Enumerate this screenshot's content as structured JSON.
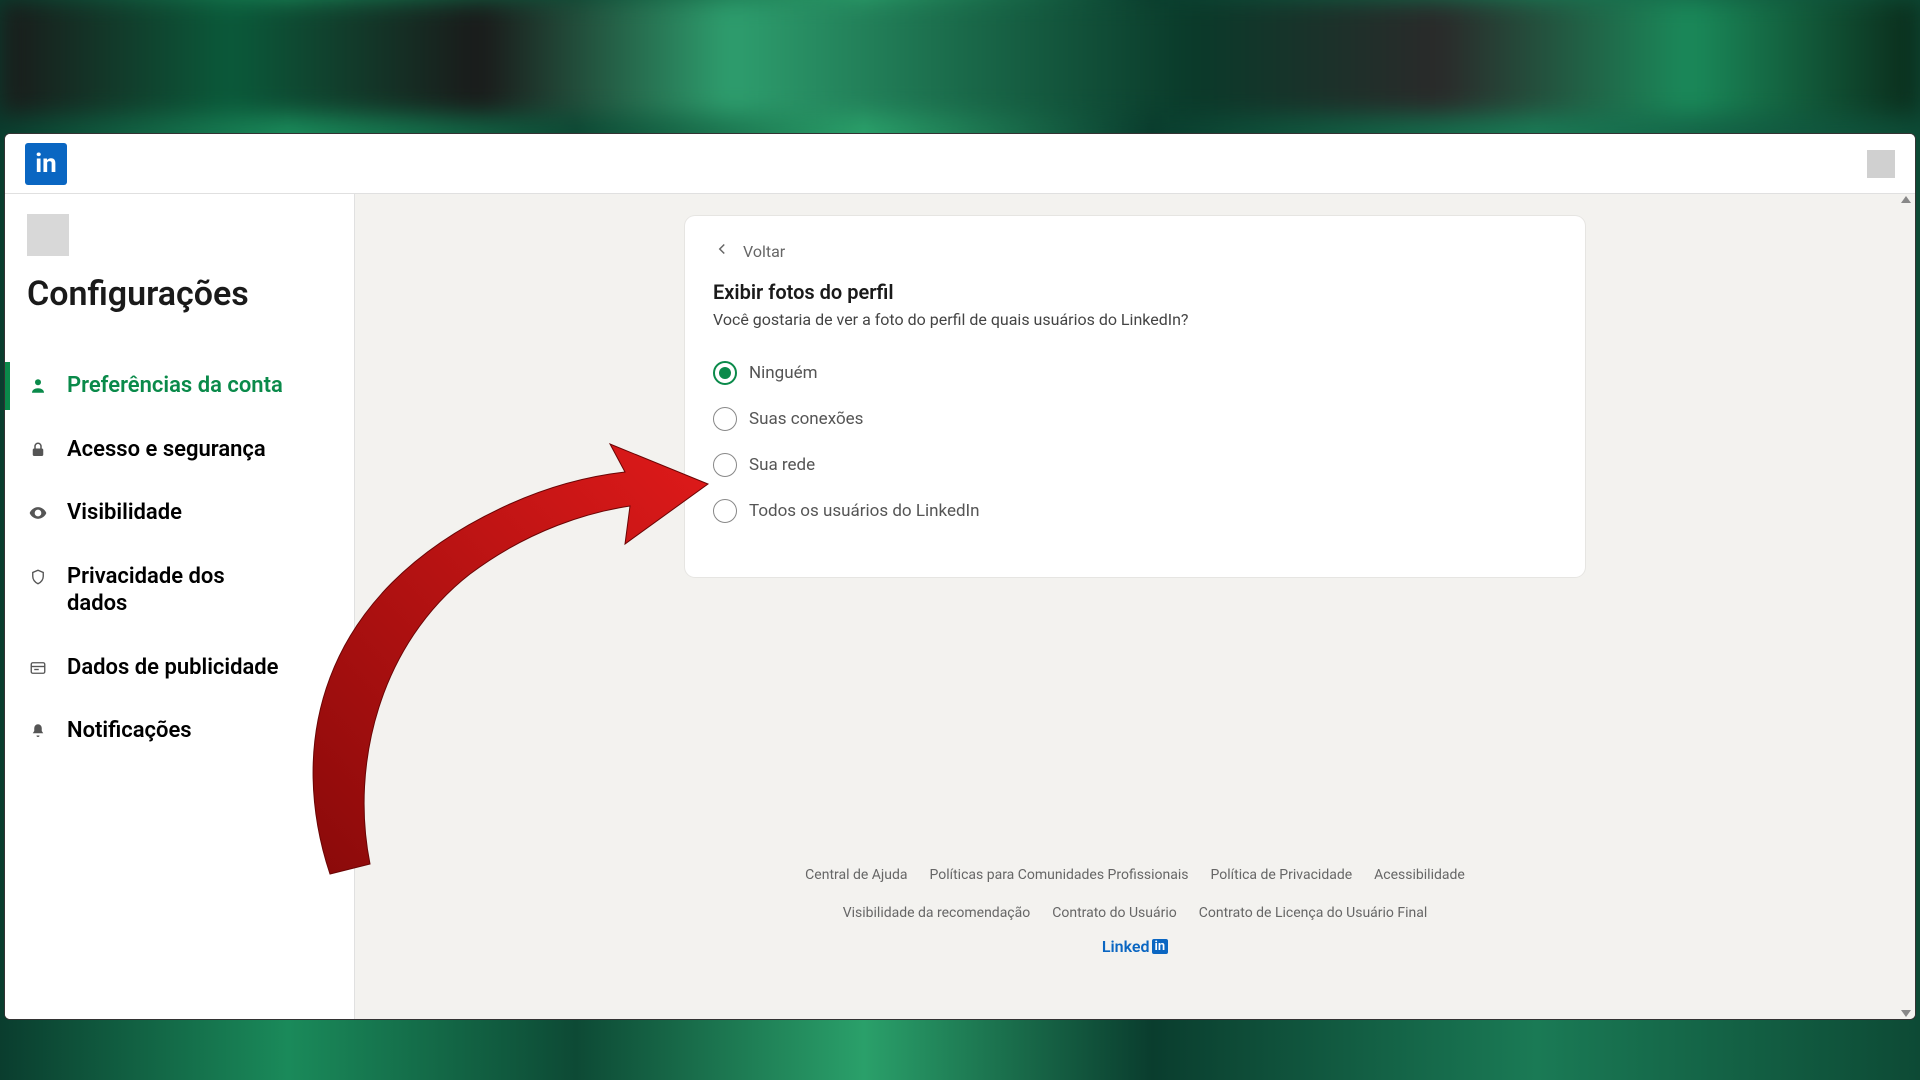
{
  "sidebar": {
    "title": "Configurações",
    "items": [
      {
        "label": "Preferências da conta",
        "active": true
      },
      {
        "label": "Acesso e segurança",
        "active": false
      },
      {
        "label": "Visibilidade",
        "active": false
      },
      {
        "label": "Privacidade dos dados",
        "active": false
      },
      {
        "label": "Dados de publicidade",
        "active": false
      },
      {
        "label": "Notificações",
        "active": false
      }
    ]
  },
  "card": {
    "back_label": "Voltar",
    "heading": "Exibir fotos do perfil",
    "subheading": "Você gostaria de ver a foto do perfil de quais usuários do LinkedIn?",
    "options": [
      {
        "label": "Ninguém",
        "selected": true
      },
      {
        "label": "Suas conexões",
        "selected": false
      },
      {
        "label": "Sua rede",
        "selected": false
      },
      {
        "label": "Todos os usuários do LinkedIn",
        "selected": false
      }
    ]
  },
  "footer": {
    "links": [
      "Central de Ajuda",
      "Políticas para Comunidades Profissionais",
      "Política de Privacidade",
      "Acessibilidade",
      "Visibilidade da recomendação",
      "Contrato do Usuário",
      "Contrato de Licença do Usuário Final"
    ],
    "brand_text": "Linked",
    "brand_in": "in"
  }
}
